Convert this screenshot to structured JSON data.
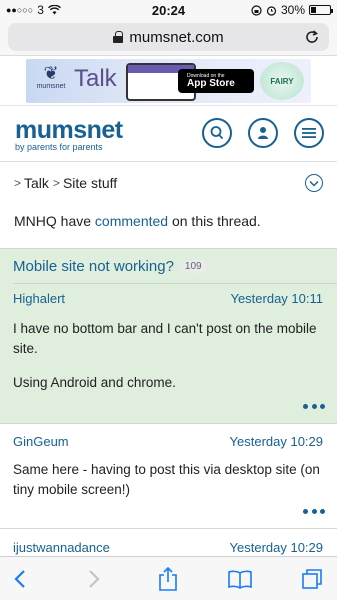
{
  "status_bar": {
    "carrier": "3",
    "time": "20:24",
    "battery": "30%",
    "battery_level": 0.3
  },
  "browser": {
    "url": "mumsnet.com"
  },
  "ad": {
    "talk_text": "Talk",
    "appstore_small": "Download on the",
    "appstore_big": "App Store",
    "fairy_text": "FAIRY"
  },
  "site": {
    "brand": "mumsnet",
    "tagline": "by parents for parents"
  },
  "breadcrumb": {
    "items": [
      "Talk",
      "Site stuff"
    ]
  },
  "mnhq_note": {
    "prefix": "MNHQ have ",
    "link": "commented",
    "suffix": " on this thread."
  },
  "thread": {
    "title": "Mobile site not working?",
    "count": "109"
  },
  "posts": [
    {
      "author": "Highalert",
      "time": "Yesterday 10:11",
      "body_1": "I have no bottom bar and I can't post on the mobile site.",
      "body_2": "Using Android and chrome."
    },
    {
      "author": "GinGeum",
      "time": "Yesterday 10:29",
      "body_1": "Same here - having to post this via desktop site (on tiny mobile screen!)"
    },
    {
      "author": "ijustwannadance",
      "time": "Yesterday 10:29"
    }
  ],
  "toolbar": {
    "icons": [
      "back-icon",
      "forward-icon",
      "share-icon",
      "bookmarks-icon",
      "tabs-icon"
    ]
  },
  "colors": {
    "accent": "#186192",
    "thread_bg": "#dfeedd",
    "ios_blue": "#1a7cf5"
  }
}
